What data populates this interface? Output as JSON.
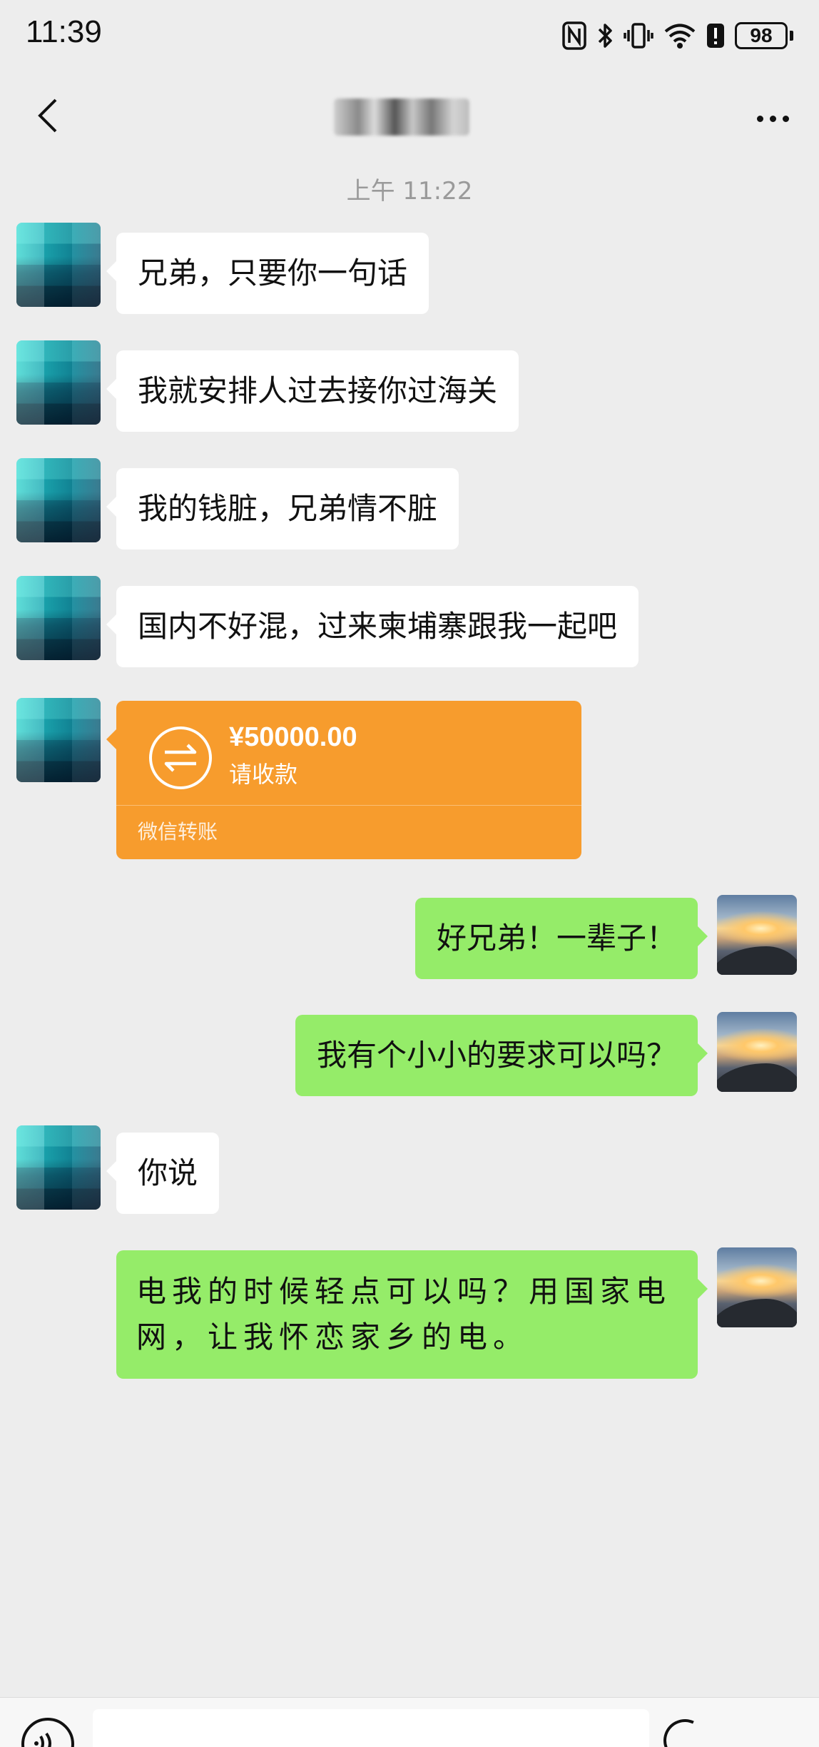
{
  "status_bar": {
    "time": "11:39",
    "battery": "98"
  },
  "nav": {
    "title": "雷哥",
    "back_icon": "chevron-left-icon",
    "more_icon": "more-horizontal-icon"
  },
  "timestamp": "上午 11:22",
  "messages": [
    {
      "side": "left",
      "type": "text",
      "text": "兄弟，只要你一句话"
    },
    {
      "side": "left",
      "type": "text",
      "text": "我就安排人过去接你过海关"
    },
    {
      "side": "left",
      "type": "text",
      "text": "我的钱脏，兄弟情不脏"
    },
    {
      "side": "left",
      "type": "text",
      "text": "国内不好混，过来柬埔寨跟我一起吧"
    },
    {
      "side": "left",
      "type": "transfer",
      "amount": "¥50000.00",
      "note": "请收款",
      "footer": "微信转账"
    },
    {
      "side": "right",
      "type": "text",
      "text": "好兄弟！一辈子！"
    },
    {
      "side": "right",
      "type": "text",
      "text": "我有个小小的要求可以吗？"
    },
    {
      "side": "left",
      "type": "text",
      "text": "你说"
    },
    {
      "side": "right",
      "type": "text",
      "text": "电我的时候轻点可以吗？用国家电网，让我怀恋家乡的电。"
    }
  ],
  "colors": {
    "background": "#ededed",
    "bubble_in": "#ffffff",
    "bubble_out": "#95ec69",
    "transfer": "#f79c2d",
    "timestamp": "#9a9a9a"
  },
  "bottom_bar": {
    "voice_icon": "voice-icon",
    "emoji_icon": "emoji-icon"
  }
}
